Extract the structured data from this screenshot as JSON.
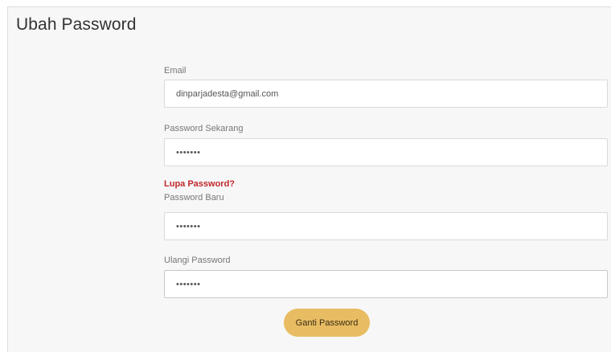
{
  "page": {
    "title": "Ubah Password"
  },
  "form": {
    "email": {
      "label": "Email",
      "value": "dinparjadesta@gmail.com"
    },
    "current_password": {
      "label": "Password Sekarang",
      "value": "1234567"
    },
    "forgot_link": "Lupa Password?",
    "new_password": {
      "label": "Password Baru",
      "value": "1234567"
    },
    "confirm_password": {
      "label": "Ulangi Password",
      "value": "1234567"
    },
    "submit_label": "Ganti Password"
  },
  "colors": {
    "panel_background": "#f7f7f7",
    "link": "#c0282d",
    "button": "#e8bc62"
  }
}
